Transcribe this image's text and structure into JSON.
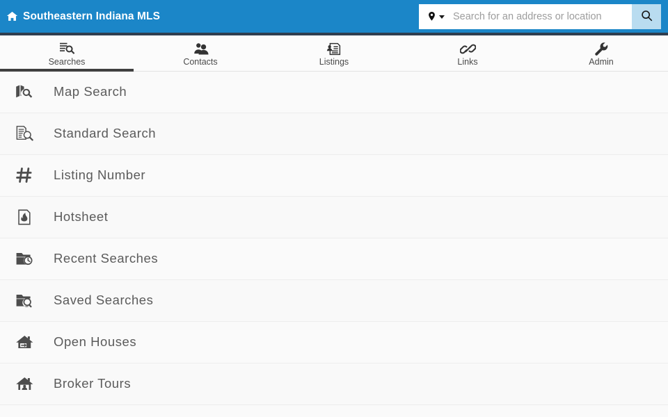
{
  "header": {
    "brand_title": "Southeastern Indiana MLS",
    "home_icon": "home-icon",
    "brand_color": "#1b86c8",
    "rule_color": "#2f3e4f",
    "search": {
      "pin_icon": "location-pin-icon",
      "caret_icon": "chevron-down-icon",
      "placeholder": "Search for an address or location",
      "value": "",
      "button_icon": "search-icon",
      "button_color": "#b9dcf0"
    }
  },
  "tabs": {
    "active_index": 0,
    "active_underline_color": "#404040",
    "items": [
      {
        "label": "Searches",
        "icon": "document-search-icon"
      },
      {
        "label": "Contacts",
        "icon": "contacts-people-icon"
      },
      {
        "label": "Listings",
        "icon": "listing-document-person-icon"
      },
      {
        "label": "Links",
        "icon": "chain-link-icon"
      },
      {
        "label": "Admin",
        "icon": "wrench-icon"
      }
    ]
  },
  "menu": {
    "items": [
      {
        "label": "Map Search",
        "icon": "map-search-icon"
      },
      {
        "label": "Standard Search",
        "icon": "document-search-icon"
      },
      {
        "label": "Listing Number",
        "icon": "hash-number-icon"
      },
      {
        "label": "Hotsheet",
        "icon": "flame-document-icon"
      },
      {
        "label": "Recent Searches",
        "icon": "folder-clock-icon"
      },
      {
        "label": "Saved Searches",
        "icon": "folder-search-icon"
      },
      {
        "label": "Open Houses",
        "icon": "house-arrow-icon"
      },
      {
        "label": "Broker Tours",
        "icon": "house-person-icon"
      }
    ]
  }
}
